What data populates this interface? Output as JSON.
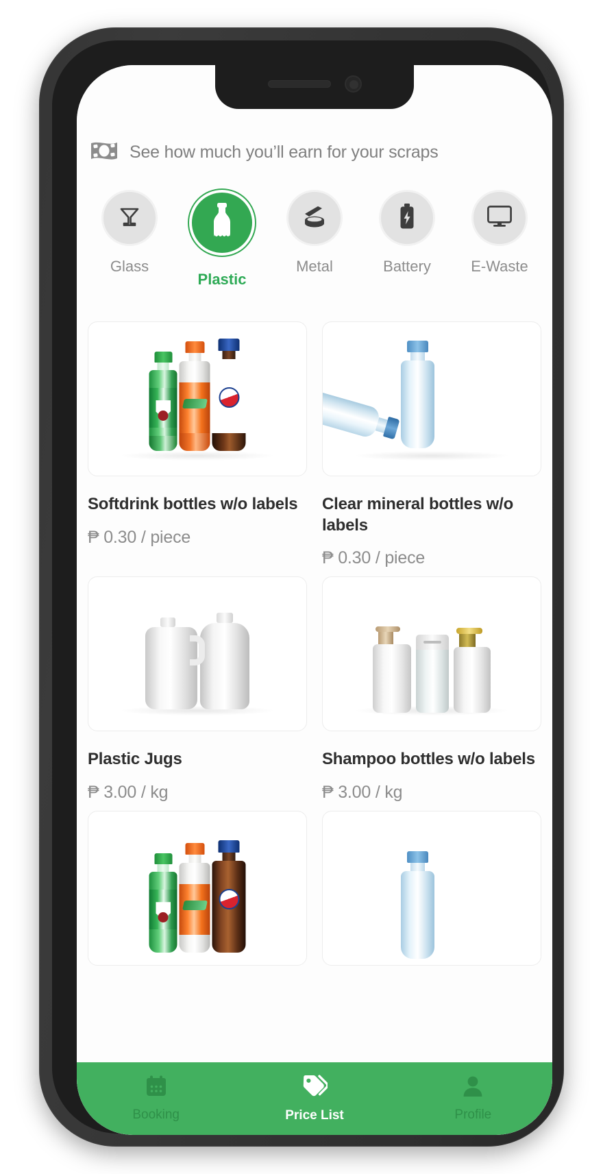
{
  "app": {
    "banner": {
      "icon": "money-banknote-icon",
      "text": "See how much you’ll earn for your scraps"
    },
    "accent_color": "#33a852",
    "nav_bar_color": "#42b05f"
  },
  "categories": [
    {
      "id": "glass",
      "label": "Glass",
      "icon": "cocktail-glass-icon",
      "active": false
    },
    {
      "id": "plastic",
      "label": "Plastic",
      "icon": "plastic-bottle-icon",
      "active": true
    },
    {
      "id": "metal",
      "label": "Metal",
      "icon": "tin-can-icon",
      "active": false
    },
    {
      "id": "battery",
      "label": "Battery",
      "icon": "battery-icon",
      "active": false
    },
    {
      "id": "ewaste",
      "label": "E-Waste",
      "icon": "monitor-icon",
      "active": false
    }
  ],
  "products": [
    {
      "title": "Softdrink bottles w/o labels",
      "price": "₱ 0.30 / piece",
      "image": "softdrink-bottles-photo"
    },
    {
      "title": "Clear mineral bottles w/o labels",
      "price": "₱ 0.30 / piece",
      "image": "clear-mineral-bottles-photo"
    },
    {
      "title": "Plastic Jugs",
      "price": "₱ 3.00 / kg",
      "image": "plastic-jugs-photo"
    },
    {
      "title": "Shampoo bottles w/o labels",
      "price": "₱ 3.00 / kg",
      "image": "shampoo-bottles-photo"
    },
    {
      "title": "",
      "price": "",
      "image": "softdrink-bottles-photo"
    },
    {
      "title": "",
      "price": "",
      "image": "clear-mineral-bottles-photo"
    }
  ],
  "bottom_nav": [
    {
      "id": "booking",
      "label": "Booking",
      "icon": "calendar-icon",
      "active": false
    },
    {
      "id": "price-list",
      "label": "Price List",
      "icon": "tag-icon",
      "active": true
    },
    {
      "id": "profile",
      "label": "Profile",
      "icon": "person-icon",
      "active": false
    }
  ]
}
